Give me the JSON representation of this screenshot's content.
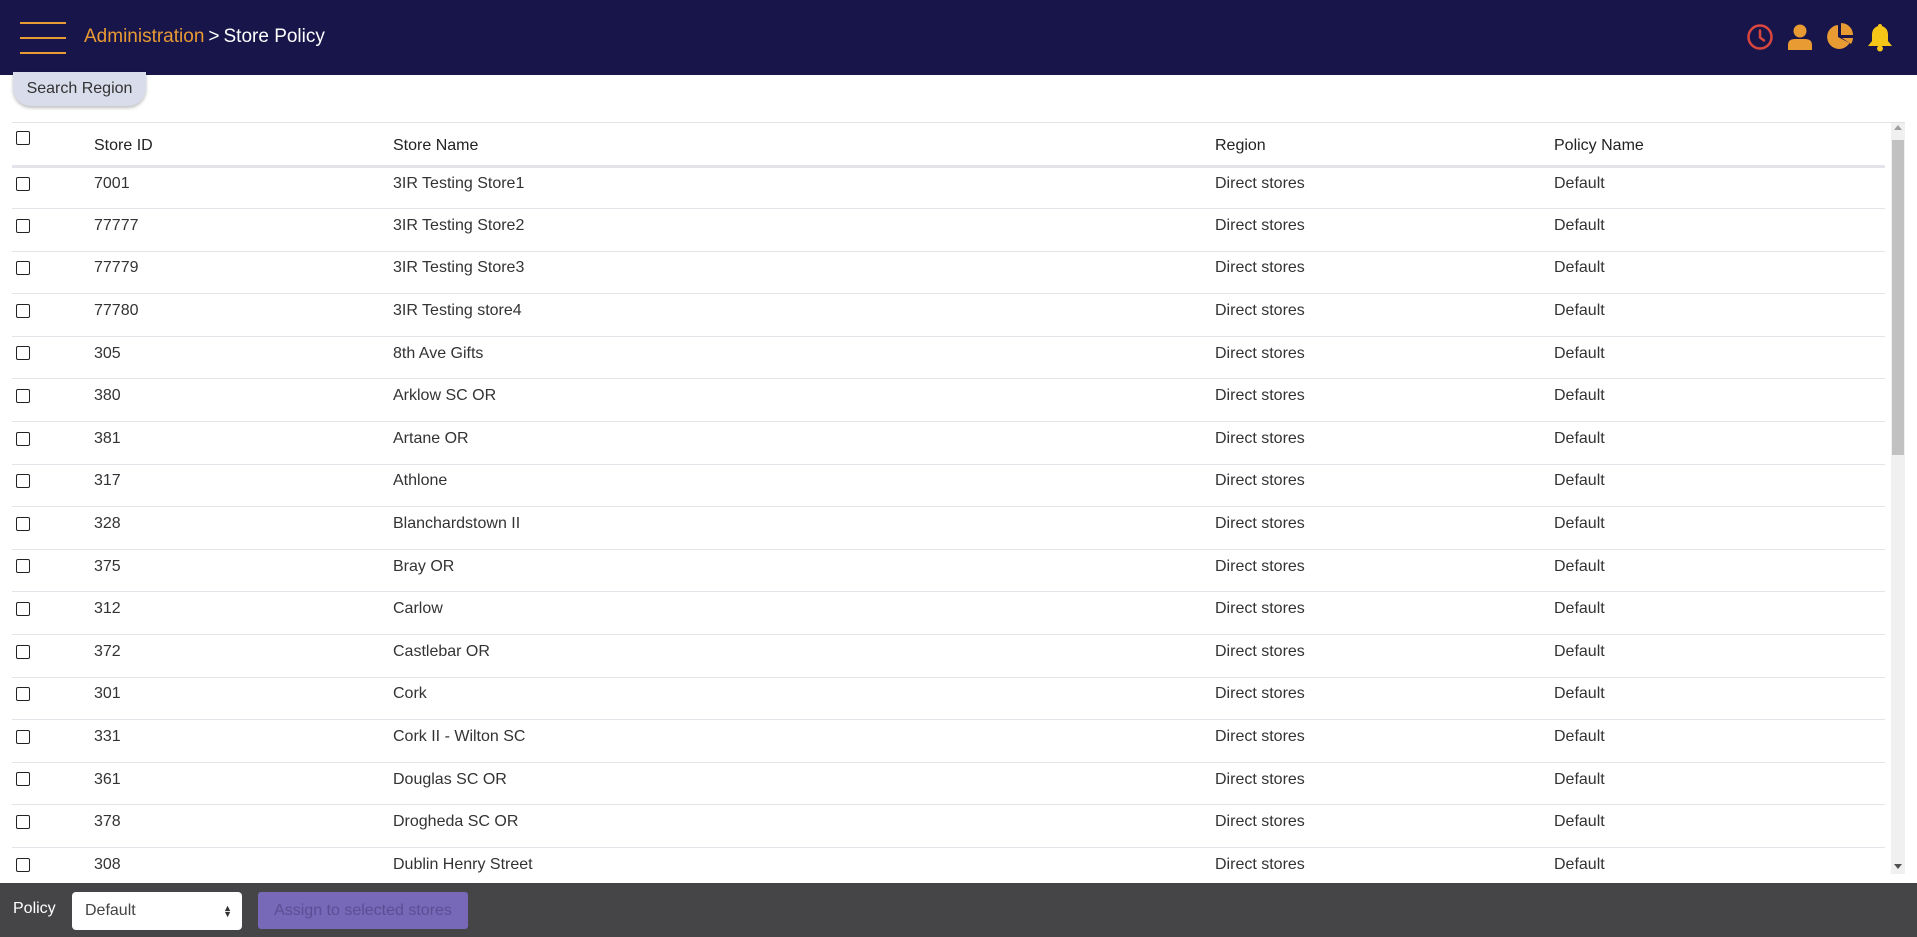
{
  "header": {
    "menu_icon": "hamburger-icon",
    "breadcrumb": {
      "parent": "Administration",
      "separator": ">",
      "current": "Store Policy"
    },
    "icons": [
      {
        "name": "clock-icon",
        "color": "#d9463e"
      },
      {
        "name": "user-icon",
        "color": "#e89a33"
      },
      {
        "name": "pie-chart-icon",
        "color": "#e89a33"
      },
      {
        "name": "bell-icon",
        "color": "#f5c518"
      }
    ],
    "accent_color": "#e89a33",
    "background_color": "#17154a"
  },
  "search_region_button": "Search Region",
  "table": {
    "columns": [
      "Store ID",
      "Store Name",
      "Region",
      "Policy Name"
    ],
    "rows": [
      {
        "id": "7001",
        "name": "3IR Testing Store1",
        "region": "Direct stores",
        "policy": "Default"
      },
      {
        "id": "77777",
        "name": "3IR Testing Store2",
        "region": "Direct stores",
        "policy": "Default"
      },
      {
        "id": "77779",
        "name": "3IR Testing Store3",
        "region": "Direct stores",
        "policy": "Default"
      },
      {
        "id": "77780",
        "name": "3IR Testing store4",
        "region": "Direct stores",
        "policy": "Default"
      },
      {
        "id": "305",
        "name": "8th Ave Gifts",
        "region": "Direct stores",
        "policy": "Default"
      },
      {
        "id": "380",
        "name": "Arklow SC OR",
        "region": "Direct stores",
        "policy": "Default"
      },
      {
        "id": "381",
        "name": "Artane OR",
        "region": "Direct stores",
        "policy": "Default"
      },
      {
        "id": "317",
        "name": "Athlone",
        "region": "Direct stores",
        "policy": "Default"
      },
      {
        "id": "328",
        "name": "Blanchardstown II",
        "region": "Direct stores",
        "policy": "Default"
      },
      {
        "id": "375",
        "name": "Bray OR",
        "region": "Direct stores",
        "policy": "Default"
      },
      {
        "id": "312",
        "name": "Carlow",
        "region": "Direct stores",
        "policy": "Default"
      },
      {
        "id": "372",
        "name": "Castlebar OR",
        "region": "Direct stores",
        "policy": "Default"
      },
      {
        "id": "301",
        "name": "Cork",
        "region": "Direct stores",
        "policy": "Default"
      },
      {
        "id": "331",
        "name": "Cork II - Wilton SC",
        "region": "Direct stores",
        "policy": "Default"
      },
      {
        "id": "361",
        "name": "Douglas SC OR",
        "region": "Direct stores",
        "policy": "Default"
      },
      {
        "id": "378",
        "name": "Drogheda SC OR",
        "region": "Direct stores",
        "policy": "Default"
      },
      {
        "id": "308",
        "name": "Dublin Henry Street",
        "region": "Direct stores",
        "policy": "Default"
      }
    ]
  },
  "footer": {
    "policy_label": "Policy",
    "policy_selected": "Default",
    "assign_button": "Assign to selected stores",
    "assign_button_color": "#7768b8"
  }
}
